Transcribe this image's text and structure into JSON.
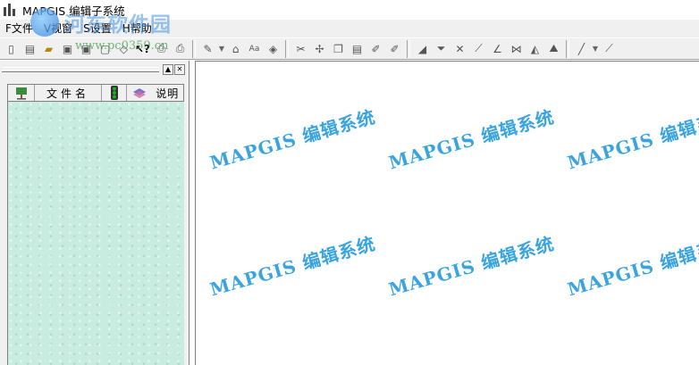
{
  "window": {
    "title": "MAPGIS 编辑子系统"
  },
  "overlay_watermark": {
    "name": "河东软件园",
    "url": "www.pc0359.cn"
  },
  "menu": [
    {
      "label": "F文件"
    },
    {
      "label": "V视窗"
    },
    {
      "label": "S设置"
    },
    {
      "label": "H帮助"
    }
  ],
  "panel": {
    "columns": [
      {
        "label": "文件名"
      },
      {
        "label": "说明"
      }
    ]
  },
  "canvas": {
    "watermark_text": "MAPGIS 编辑系统"
  }
}
